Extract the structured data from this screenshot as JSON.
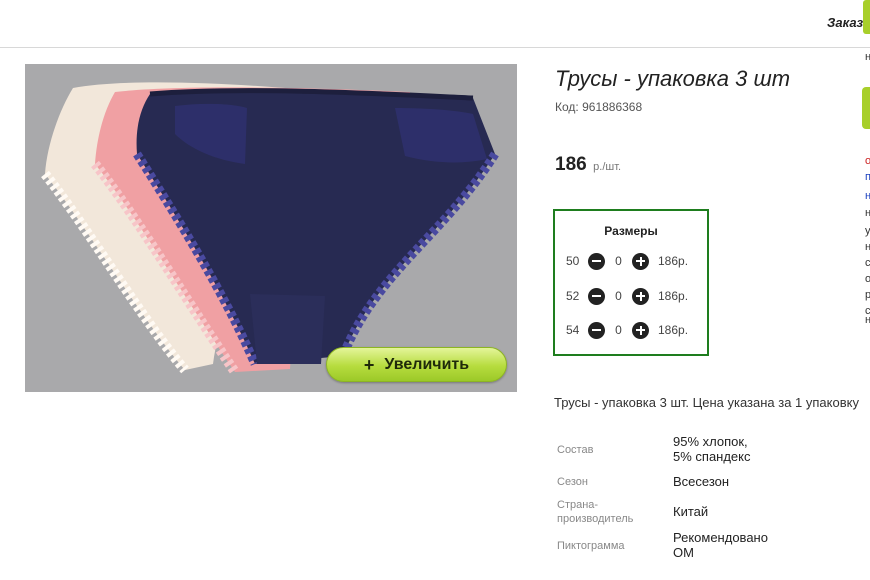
{
  "header": {
    "orders_label": "Заказ"
  },
  "product": {
    "title": "Трусы - упаковка 3 шт",
    "code_label": "Код:",
    "code": "961886368",
    "price": "186",
    "price_unit": "р./шт.",
    "zoom_label": "Увеличить",
    "zoom_plus": "+",
    "description": "Трусы - упаковка 3 шт. Цена указана за 1 упаковку"
  },
  "sizes": {
    "title": "Размеры",
    "rows": [
      {
        "size": "50",
        "qty": "0",
        "price": "186р."
      },
      {
        "size": "52",
        "qty": "0",
        "price": "186р."
      },
      {
        "size": "54",
        "qty": "0",
        "price": "186р."
      }
    ]
  },
  "attributes": [
    {
      "label": "Состав",
      "value_lines": [
        "95% хлопок,",
        "5% спандекс"
      ]
    },
    {
      "label": "Сезон",
      "value_lines": [
        "Всесезон"
      ]
    },
    {
      "label_lines": [
        "Страна-",
        "производитель"
      ],
      "value_lines": [
        "Китай"
      ]
    },
    {
      "label": "Пиктограмма",
      "value_lines": [
        "Рекомендовано",
        "ОМ"
      ]
    }
  ],
  "right_edge_chars": [
    "н",
    "о",
    "п",
    "н",
    "н",
    "у",
    "н",
    "с",
    "о",
    "р",
    "с",
    "н"
  ],
  "colors": {
    "accent_green": "#a8cf2a",
    "sizes_border": "#1e7d1e",
    "edge_red": "#cc2222",
    "edge_blue": "#1a3fbf",
    "image_bg": "#a9a9ab"
  }
}
